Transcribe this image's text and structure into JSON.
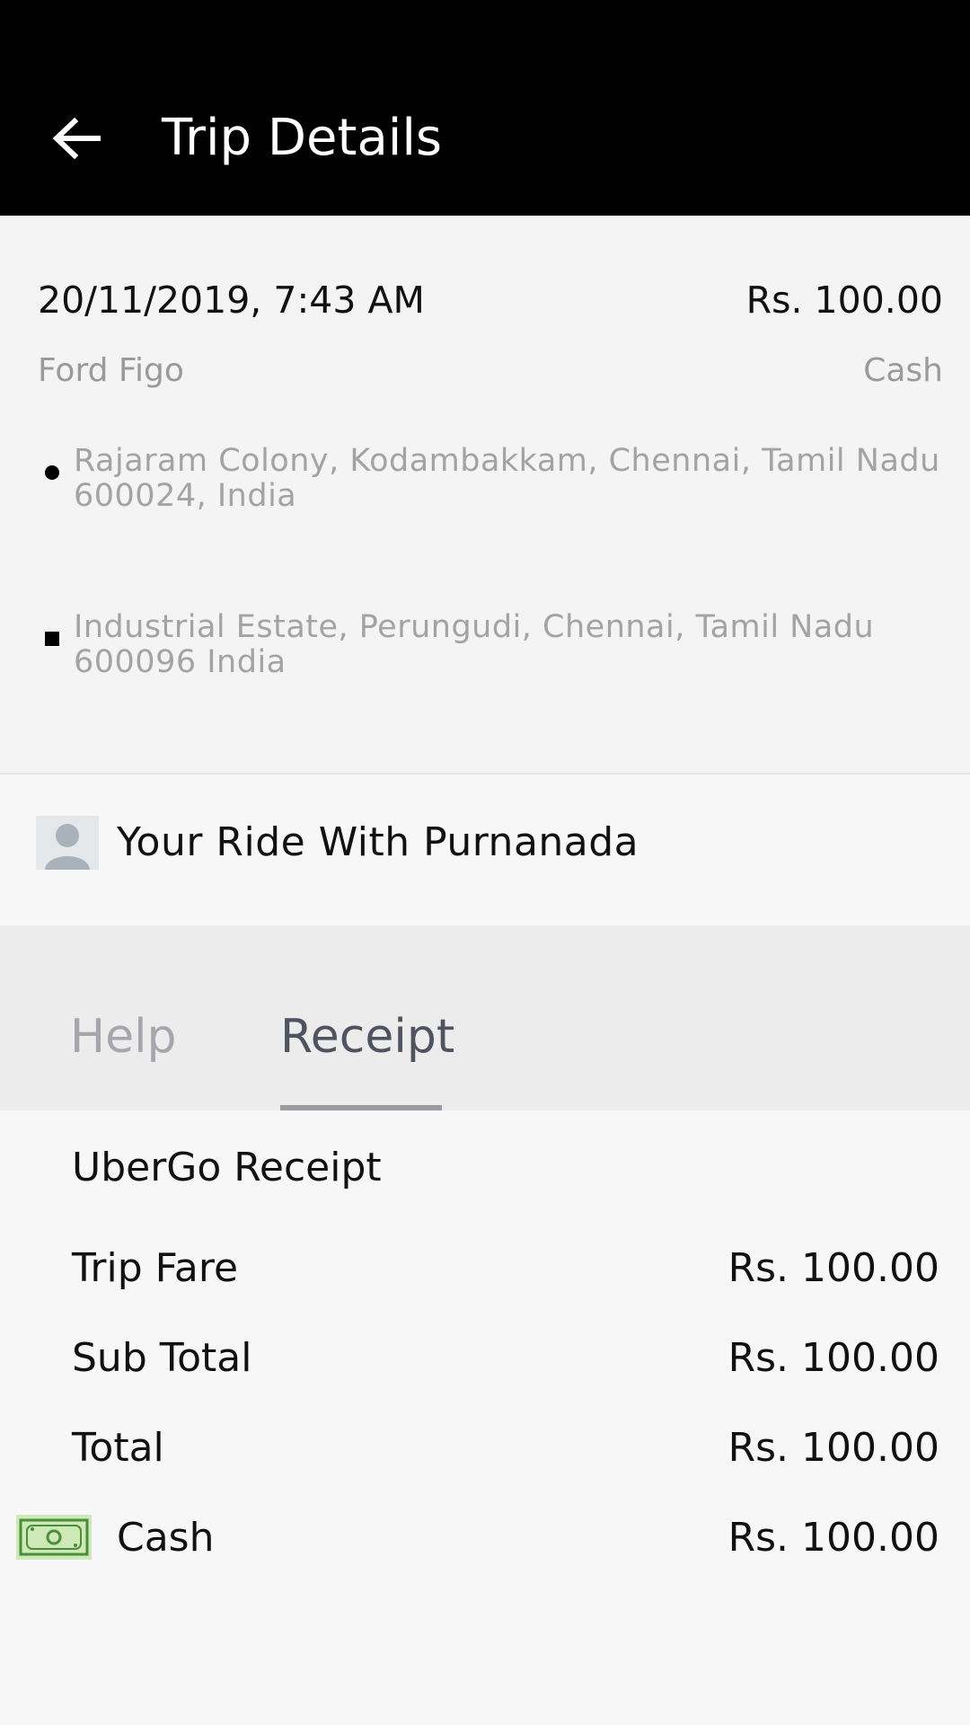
{
  "header": {
    "title": "Trip Details"
  },
  "trip": {
    "datetime": "20/11/2019, 7:43 AM",
    "fare": "Rs. 100.00",
    "car": "Ford Figo",
    "payment_method": "Cash",
    "pickup": "Rajaram Colony, Kodambakkam, Chennai, Tamil Nadu 600024, India",
    "dropoff": "Industrial Estate, Perungudi, Chennai, Tamil Nadu 600096 India"
  },
  "driver": {
    "text": "Your Ride With Purnanada"
  },
  "tabs": [
    {
      "label": "Help"
    },
    {
      "label": "Receipt"
    }
  ],
  "receipt": {
    "title": "UberGo Receipt",
    "lines": [
      {
        "label": "Trip Fare",
        "value": "Rs. 100.00"
      },
      {
        "label": "Sub Total",
        "value": "Rs. 100.00"
      },
      {
        "label": "Total",
        "value": "Rs. 100.00"
      }
    ],
    "payment": {
      "label": "Cash",
      "value": "Rs. 100.00"
    }
  }
}
